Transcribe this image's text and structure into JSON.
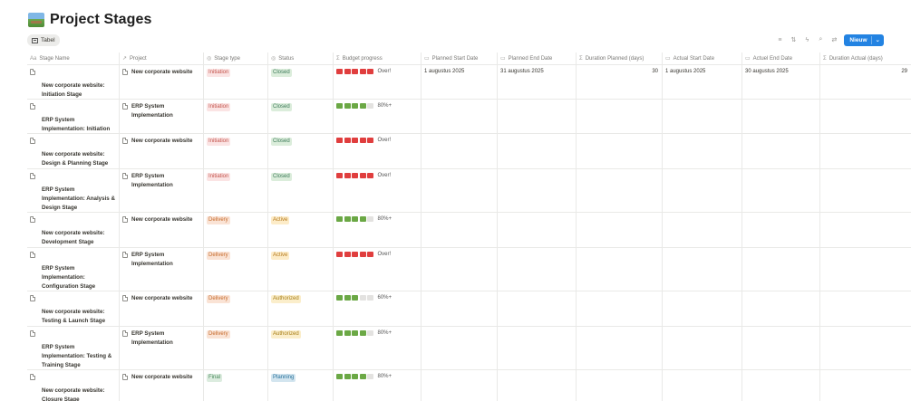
{
  "page": {
    "title": "Project Stages",
    "icon": "landscape-emoji-icon"
  },
  "view": {
    "tab_label": "Tabel"
  },
  "toolbar": {
    "new_label": "Nieuw",
    "icons": [
      "filter-icon",
      "sort-icon",
      "lightning-icon",
      "search-icon",
      "settings-icon"
    ]
  },
  "columns": [
    {
      "label": "Stage Name",
      "icon": "Aa"
    },
    {
      "label": "Project",
      "icon": "↗"
    },
    {
      "label": "Stage type",
      "icon": "◎"
    },
    {
      "label": "Status",
      "icon": "◎"
    },
    {
      "label": "Budget progress",
      "icon": "Σ"
    },
    {
      "label": "Planned Start Date",
      "icon": "▭"
    },
    {
      "label": "Planned End Date",
      "icon": "▭"
    },
    {
      "label": "Duration Planned (days)",
      "icon": "Σ"
    },
    {
      "label": "Actual Start Date",
      "icon": "▭"
    },
    {
      "label": "Actuel End Date",
      "icon": "▭"
    },
    {
      "label": "Duration Actual (days)",
      "icon": "Σ"
    }
  ],
  "rows": [
    {
      "name": "New corporate website: Initiation Stage",
      "project": "New corporate website",
      "stage_type": "Initiation",
      "status": "Closed",
      "budget_color": "red",
      "budget_fill": 5,
      "budget_label": "Over!",
      "planned_start": "1 augustus 2025",
      "planned_end": "31 augustus 2025",
      "duration_planned": "30",
      "actual_start": "1 augustus 2025",
      "actual_end": "30 augustus 2025",
      "duration_actual": "29"
    },
    {
      "name": "ERP System Implementation: Initiation Stage",
      "project": "ERP System Implementation",
      "stage_type": "Initiation",
      "status": "Closed",
      "budget_color": "green",
      "budget_fill": 4,
      "budget_label": "80%+",
      "planned_start": "",
      "planned_end": "",
      "duration_planned": "",
      "actual_start": "",
      "actual_end": "",
      "duration_actual": ""
    },
    {
      "name": "New corporate website: Design & Planning Stage",
      "project": "New corporate website",
      "stage_type": "Initiation",
      "status": "Closed",
      "budget_color": "red",
      "budget_fill": 5,
      "budget_label": "Over!",
      "planned_start": "",
      "planned_end": "",
      "duration_planned": "",
      "actual_start": "",
      "actual_end": "",
      "duration_actual": ""
    },
    {
      "name": "ERP System Implementation: Analysis & Design Stage",
      "project": "ERP System Implementation",
      "stage_type": "Initiation",
      "status": "Closed",
      "budget_color": "red",
      "budget_fill": 5,
      "budget_label": "Over!",
      "planned_start": "",
      "planned_end": "",
      "duration_planned": "",
      "actual_start": "",
      "actual_end": "",
      "duration_actual": ""
    },
    {
      "name": "New corporate website: Development Stage",
      "project": "New corporate website",
      "stage_type": "Delivery",
      "status": "Active",
      "budget_color": "green",
      "budget_fill": 4,
      "budget_label": "80%+",
      "planned_start": "",
      "planned_end": "",
      "duration_planned": "",
      "actual_start": "",
      "actual_end": "",
      "duration_actual": ""
    },
    {
      "name": "ERP System Implementation: Configuration Stage",
      "project": "ERP System Implementation",
      "stage_type": "Delivery",
      "status": "Active",
      "budget_color": "red",
      "budget_fill": 5,
      "budget_label": "Over!",
      "planned_start": "",
      "planned_end": "",
      "duration_planned": "",
      "actual_start": "",
      "actual_end": "",
      "duration_actual": ""
    },
    {
      "name": "New corporate website: Testing & Launch Stage",
      "project": "New corporate website",
      "stage_type": "Delivery",
      "status": "Authorized",
      "budget_color": "green",
      "budget_fill": 3,
      "budget_label": "60%+",
      "planned_start": "",
      "planned_end": "",
      "duration_planned": "",
      "actual_start": "",
      "actual_end": "",
      "duration_actual": ""
    },
    {
      "name": "ERP System Implementation: Testing & Training Stage",
      "project": "ERP System Implementation",
      "stage_type": "Delivery",
      "status": "Authorized",
      "budget_color": "green",
      "budget_fill": 4,
      "budget_label": "80%+",
      "planned_start": "",
      "planned_end": "",
      "duration_planned": "",
      "actual_start": "",
      "actual_end": "",
      "duration_actual": ""
    },
    {
      "name": "New corporate website: Closure Stage",
      "project": "New corporate website",
      "stage_type": "Final",
      "status": "Planning",
      "budget_color": "green",
      "budget_fill": 4,
      "budget_label": "80%+",
      "planned_start": "",
      "planned_end": "",
      "duration_planned": "",
      "actual_start": "",
      "actual_end": "",
      "duration_actual": ""
    }
  ]
}
